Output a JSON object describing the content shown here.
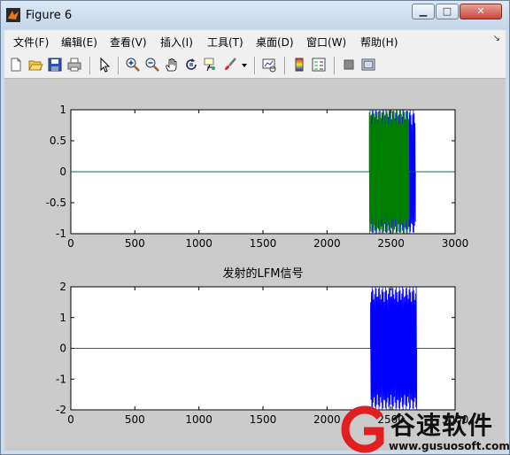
{
  "window": {
    "title": "Figure 6",
    "minimize": "▁",
    "maximize": "□",
    "close": "✕"
  },
  "menubar": {
    "items": [
      "文件(F)",
      "编辑(E)",
      "查看(V)",
      "插入(I)",
      "工具(T)",
      "桌面(D)",
      "窗口(W)",
      "帮助(H)"
    ],
    "overflow": "↘"
  },
  "toolbar": {
    "icons": [
      "new-figure-icon",
      "open-file-icon",
      "save-icon",
      "print-icon",
      "pointer-icon",
      "zoom-in-icon",
      "zoom-out-icon",
      "pan-icon",
      "rotate-3d-icon",
      "data-cursor-icon",
      "brush-icon",
      "brush-dropdown-icon",
      "link-plot-icon",
      "colorbar-icon",
      "legend-icon",
      "hide-plot-tools-icon",
      "show-plot-tools-icon"
    ]
  },
  "chart_data": [
    {
      "type": "line",
      "title": "",
      "xlim": [
        0,
        3000
      ],
      "ylim": [
        -1,
        1
      ],
      "xticks": [
        "0",
        "500",
        "1000",
        "1500",
        "2000",
        "2500",
        "3000"
      ],
      "yticks": [
        "1",
        "0.5",
        "0",
        "-0.5",
        "-1"
      ],
      "series": [
        {
          "color": "#0000ff",
          "segments": [
            {
              "x": [
                0,
                2340
              ],
              "y": [
                0,
                0
              ]
            },
            {
              "x_start": 2340,
              "x_end": 2690,
              "amplitude": 1,
              "kind": "oscillation"
            },
            {
              "x": [
                2690,
                3000
              ],
              "y": [
                0,
                0
              ]
            }
          ]
        },
        {
          "color": "#008000",
          "segments": [
            {
              "x": [
                0,
                2330
              ],
              "y": [
                0,
                0
              ]
            },
            {
              "x_start": 2330,
              "x_end": 2640,
              "amplitude": 1,
              "kind": "oscillation"
            },
            {
              "x": [
                2640,
                3000
              ],
              "y": [
                0,
                0
              ]
            }
          ]
        }
      ]
    },
    {
      "type": "line",
      "title": "发射的LFM信号",
      "xlim": [
        0,
        3000
      ],
      "ylim": [
        -2,
        2
      ],
      "xticks": [
        "0",
        "500",
        "1000",
        "1500",
        "2000",
        "2500",
        "3000"
      ],
      "yticks": [
        "2",
        "1",
        "0",
        "-1",
        "-2"
      ],
      "series": [
        {
          "color": "#0000ff",
          "segments": [
            {
              "x": [
                0,
                2340
              ],
              "y": [
                0,
                0
              ]
            },
            {
              "x_start": 2340,
              "x_end": 2700,
              "amplitude": 2,
              "kind": "oscillation"
            },
            {
              "x": [
                2700,
                3000
              ],
              "y": [
                0,
                0
              ]
            }
          ]
        }
      ]
    }
  ],
  "watermark": {
    "text": "谷速软件",
    "url": "www.gusuosoft.com",
    "accent": "#e02020"
  }
}
